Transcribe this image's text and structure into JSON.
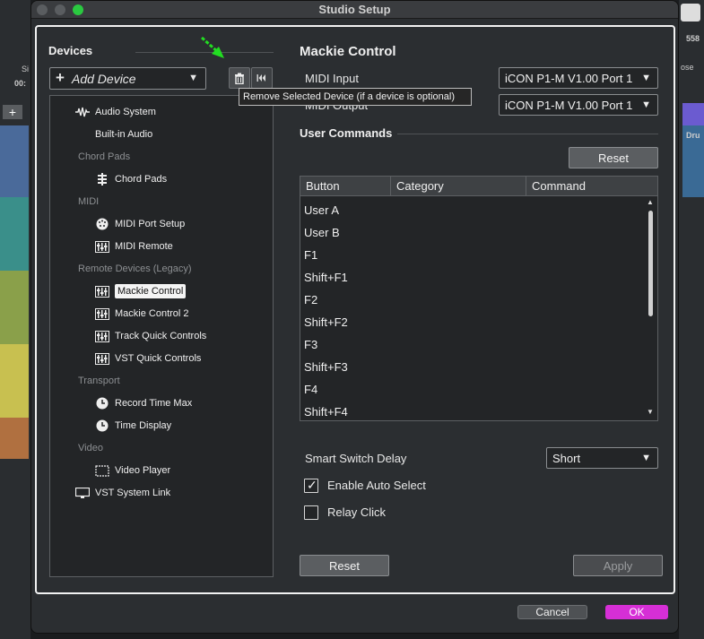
{
  "window": {
    "title": "Studio Setup"
  },
  "background": {
    "left_timecode": "00:",
    "left_small": "Si",
    "right_number": "558",
    "right_small": "ose",
    "right_clip": "Dru"
  },
  "devices": {
    "title": "Devices",
    "add_device_label": "Add Device",
    "tooltip": "Remove Selected Device (if a device is optional)",
    "tree": [
      {
        "type": "item",
        "label": "Audio System",
        "icon": "waveform-icon"
      },
      {
        "type": "item",
        "label": "Built-in Audio",
        "icon": ""
      },
      {
        "type": "category",
        "label": "Chord Pads"
      },
      {
        "type": "item",
        "label": "Chord Pads",
        "icon": "chord-pads-icon"
      },
      {
        "type": "category",
        "label": "MIDI"
      },
      {
        "type": "item",
        "label": "MIDI Port Setup",
        "icon": "midi-port-icon"
      },
      {
        "type": "item",
        "label": "MIDI Remote",
        "icon": "fader-icon"
      },
      {
        "type": "category",
        "label": "Remote Devices (Legacy)"
      },
      {
        "type": "item",
        "label": "Mackie Control",
        "icon": "fader-icon",
        "selected": true
      },
      {
        "type": "item",
        "label": "Mackie Control 2",
        "icon": "fader-icon"
      },
      {
        "type": "item",
        "label": "Track Quick Controls",
        "icon": "fader-icon"
      },
      {
        "type": "item",
        "label": "VST Quick Controls",
        "icon": "fader-icon"
      },
      {
        "type": "category",
        "label": "Transport"
      },
      {
        "type": "item",
        "label": "Record Time Max",
        "icon": "clock-icon"
      },
      {
        "type": "item",
        "label": "Time Display",
        "icon": "clock-icon"
      },
      {
        "type": "category",
        "label": "Video"
      },
      {
        "type": "item",
        "label": "Video Player",
        "icon": "video-icon"
      },
      {
        "type": "item",
        "label": "VST System Link",
        "icon": "monitor-icon"
      }
    ]
  },
  "mackie": {
    "title": "Mackie Control",
    "midi_input_label": "MIDI Input",
    "midi_input_value": "iCON P1-M V1.00  Port 1",
    "midi_output_label": "MIDI Output",
    "midi_output_value": "iCON P1-M V1.00  Port 1",
    "user_commands_title": "User Commands",
    "reset_label": "Reset",
    "columns": [
      "Button",
      "Category",
      "Command"
    ],
    "rows": [
      "User A",
      "User B",
      "F1",
      "Shift+F1",
      "F2",
      "Shift+F2",
      "F3",
      "Shift+F3",
      "F4",
      "Shift+F4"
    ],
    "smart_switch_label": "Smart Switch Delay",
    "smart_switch_value": "Short",
    "enable_auto_select_label": "Enable Auto Select",
    "enable_auto_select_checked": true,
    "relay_click_label": "Relay Click",
    "relay_click_checked": false,
    "bottom_reset_label": "Reset",
    "apply_label": "Apply"
  },
  "footer": {
    "cancel_label": "Cancel",
    "ok_label": "OK"
  },
  "colors": {
    "ok": "#d62fd6",
    "accent_green": "#2ac940",
    "arrow": "#22dd22"
  }
}
